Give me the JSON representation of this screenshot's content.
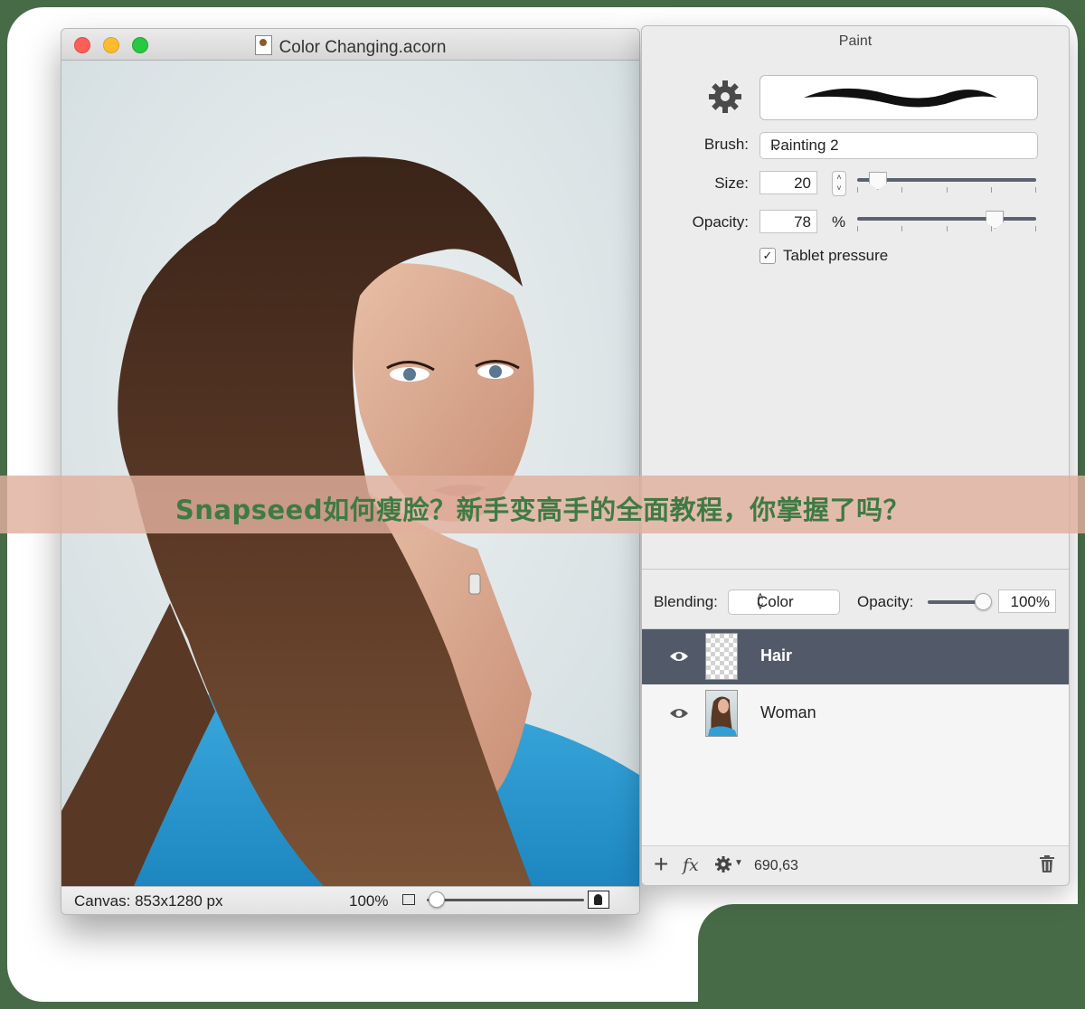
{
  "canvas_window": {
    "title": "Color Changing.acorn",
    "doc_icon": "acorn-document-icon",
    "status": {
      "canvas_size": "Canvas: 853x1280 px",
      "zoom": "100%"
    }
  },
  "paint_panel": {
    "title": "Paint",
    "brush_label": "Brush:",
    "brush_value": "Painting 2",
    "size_label": "Size:",
    "size_value": "20",
    "size_slider_fraction": 0.1,
    "opacity_label": "Opacity:",
    "opacity_value": "78",
    "opacity_unit": "%",
    "opacity_slider_fraction": 0.76,
    "tablet_pressure_label": "Tablet pressure",
    "tablet_pressure_checked": true
  },
  "layers_panel": {
    "blending_label": "Blending:",
    "blending_value": "Color",
    "opacity_label": "Opacity:",
    "opacity_value": "100%",
    "layers": [
      {
        "name": "Hair",
        "visible": true,
        "selected": true
      },
      {
        "name": "Woman",
        "visible": true,
        "selected": false
      }
    ],
    "footer": {
      "add_icon": "plus-icon",
      "fx_label": "fx",
      "settings_icon": "gear-icon",
      "coordinates": "690,63",
      "delete_icon": "trash-icon"
    }
  },
  "banner": {
    "text": "Snapseed如何瘦脸？新手变高手的全面教程，你掌握了吗？"
  },
  "colors": {
    "selection": "#525a69",
    "banner_bg": "#e0b09e",
    "banner_text": "#3f7a44",
    "outer_bg": "#476b47"
  }
}
